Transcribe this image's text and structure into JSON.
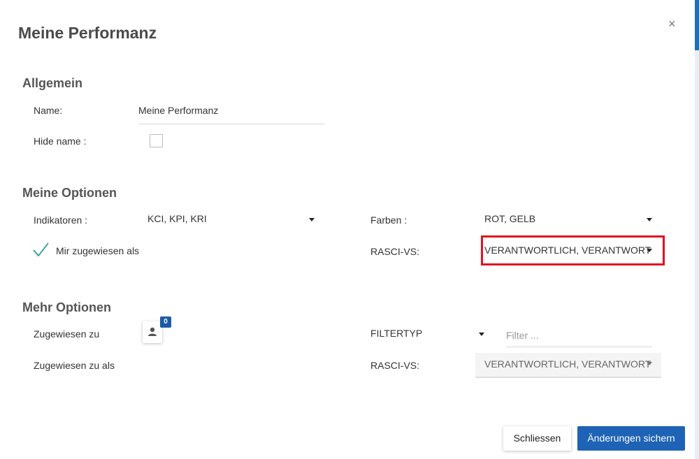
{
  "dialog": {
    "title": "Meine Performanz",
    "close_glyph": "×"
  },
  "allgemein": {
    "title": "Allgemein",
    "name_label": "Name:",
    "name_value": "Meine Performanz",
    "hide_name_label": "Hide name :",
    "hide_name_checked": false
  },
  "meine_optionen": {
    "title": "Meine Optionen",
    "indikatoren_label": "Indikatoren :",
    "indikatoren_value": "KCI, KPI, KRI",
    "farben_label": "Farben :",
    "farben_value": "ROT, GELB",
    "mir_zugewiesen_label": "Mir zugewiesen als",
    "mir_zugewiesen_checked": true,
    "rasci_label": "RASCI-VS:",
    "rasci_value": "VERANTWORTLICH, VERANTWORT"
  },
  "mehr_optionen": {
    "title": "Mehr Optionen",
    "zugewiesen_zu_label": "Zugewiesen zu",
    "user_count": "0",
    "filtertyp_label": "FILTERTYP",
    "filter_placeholder": "Filter ...",
    "zugewiesen_zu_als_label": "Zugewiesen zu als",
    "rasci_label": "RASCI-VS:",
    "rasci_value": "VERANTWORTLICH, VERANTWORT"
  },
  "footer": {
    "close_label": "Schliessen",
    "save_label": "Änderungen sichern"
  },
  "colors": {
    "accent": "#1e63b5",
    "highlight": "#e0141e",
    "check": "#2a9d8f"
  },
  "icons": {
    "close": "close-icon",
    "check": "check-icon",
    "user": "user-icon",
    "caret": "chevron-down-icon"
  }
}
